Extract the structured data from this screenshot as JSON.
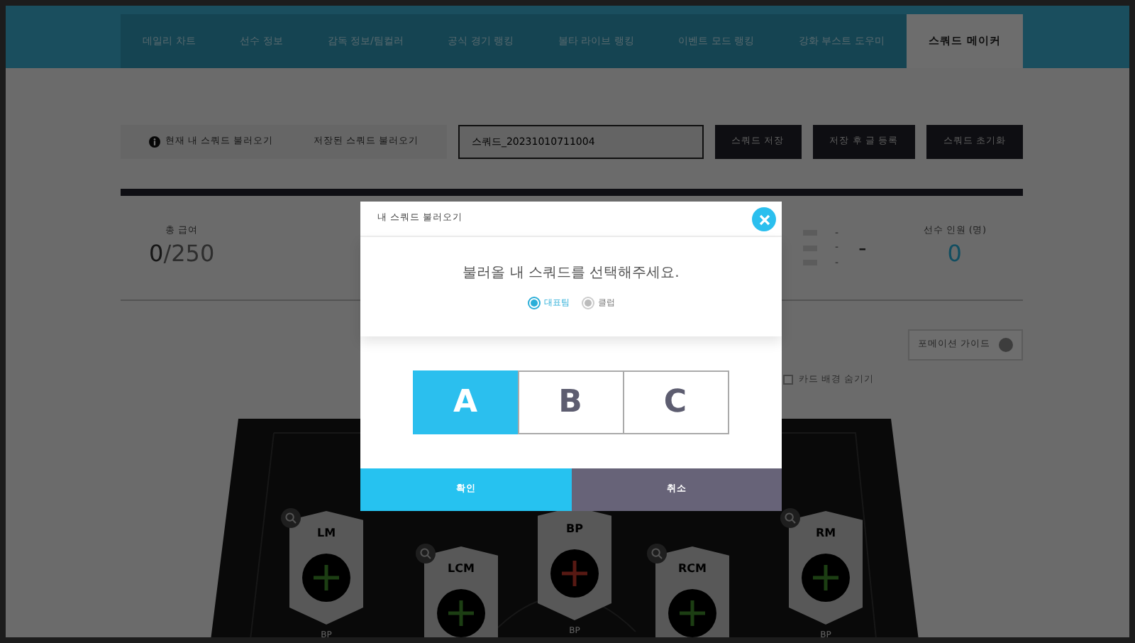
{
  "tabs": [
    {
      "label": "데일리 차트",
      "selected": false
    },
    {
      "label": "선수 정보",
      "selected": false
    },
    {
      "label": "감독 정보/팀컬러",
      "selected": false
    },
    {
      "label": "공식 경기 랭킹",
      "selected": false
    },
    {
      "label": "볼타 라이브 랭킹",
      "selected": false
    },
    {
      "label": "이벤트 모드 랭킹",
      "selected": false
    },
    {
      "label": "강화 부스트 도우미",
      "selected": false
    },
    {
      "label": "스쿼드 메이커",
      "selected": true
    }
  ],
  "toolbar": {
    "load_options": [
      {
        "label": "현재 내 스쿼드 불러오기"
      },
      {
        "label": "저장된 스쿼드 불러오기"
      }
    ],
    "squad_name": "스쿼드_20231010711004",
    "buttons": [
      "스쿼드 저장",
      "저장 후 글 등록",
      "스쿼드 초기화"
    ]
  },
  "stats": {
    "salary": {
      "label": "총 급여",
      "value": "0",
      "max": "/250"
    },
    "dash_rows": [
      "-",
      "-",
      "-"
    ],
    "middle_value": "-",
    "players": {
      "label": "선수 인원 (명)",
      "value": "0"
    }
  },
  "guide_button": "포메이션 가이드",
  "hide_background": {
    "label": "카드 배경 숨기기",
    "checked": false
  },
  "pitch": {
    "cards": [
      {
        "kind": "slot",
        "position": "LM",
        "rating": "BP"
      },
      {
        "kind": "slot",
        "position": "LCM"
      },
      {
        "kind": "center",
        "position": "BP",
        "rating": "BP"
      },
      {
        "kind": "slot",
        "position": "RCM"
      },
      {
        "kind": "slot",
        "position": "RM",
        "rating": "BP"
      }
    ]
  },
  "modal": {
    "title": "내 스쿼드 불러오기",
    "message": "불러올 내 스쿼드를 선택해주세요.",
    "team_types": [
      {
        "label": "대표팀",
        "selected": true
      },
      {
        "label": "클럽",
        "selected": false
      }
    ],
    "squads": [
      {
        "label": "A",
        "selected": true
      },
      {
        "label": "B",
        "selected": false
      },
      {
        "label": "C",
        "selected": false
      }
    ],
    "confirm": "확인",
    "cancel": "취소"
  }
}
